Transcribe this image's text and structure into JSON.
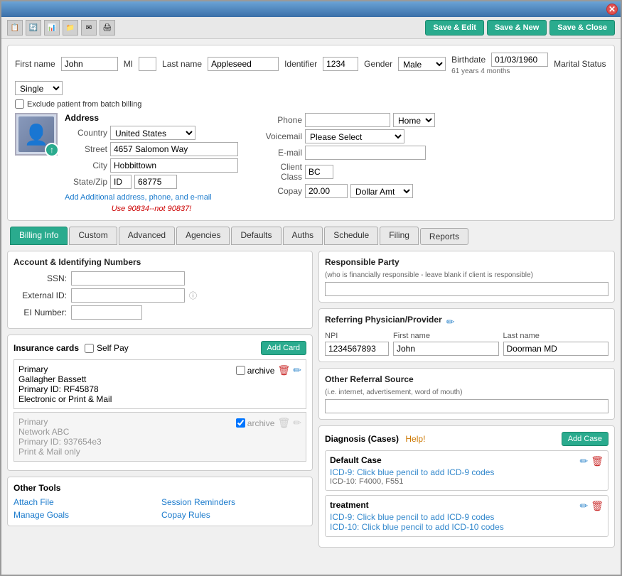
{
  "window": {
    "close_icon": "✕"
  },
  "toolbar": {
    "icons": [
      "📋",
      "🔄",
      "📊",
      "📁",
      "✉",
      "🖨"
    ],
    "save_edit": "Save & Edit",
    "save_new": "Save & New",
    "save_close": "Save & Close"
  },
  "patient": {
    "first_name_label": "First name",
    "first_name": "John",
    "mi_label": "MI",
    "last_name_label": "Last name",
    "last_name": "Appleseed",
    "identifier_label": "Identifier",
    "identifier": "1234",
    "gender_label": "Gender",
    "gender": "Male",
    "birthdate_label": "Birthdate",
    "birthdate": "01/03/1960",
    "birthdate_sub": "61 years 4 months",
    "marital_label": "Marital Status",
    "marital": "Single",
    "exclude_label": "Exclude patient from batch billing",
    "address_title": "Address",
    "country_label": "Country",
    "country": "United States",
    "street_label": "Street",
    "street": "4657 Salomon Way",
    "city_label": "City",
    "city": "Hobbittown",
    "state_label": "State/Zip",
    "state": "ID",
    "zip": "68775",
    "add_address_link": "Add Additional address, phone, and e-mail",
    "warning": "Use 90834--not 90837!",
    "phone_label": "Phone",
    "phone_type": "Home",
    "voicemail_label": "Voicemail",
    "voicemail_placeholder": "Please Select",
    "email_label": "E-mail",
    "client_class_label": "Client Class",
    "client_class": "BC",
    "copay_label": "Copay",
    "copay": "20.00",
    "copay_type": "Dollar Amt"
  },
  "tabs": {
    "billing_info": "Billing Info",
    "custom": "Custom",
    "advanced": "Advanced",
    "agencies": "Agencies",
    "defaults": "Defaults",
    "auths": "Auths",
    "schedule": "Schedule",
    "filing": "Filing",
    "reports": "Reports"
  },
  "account": {
    "title": "Account & Identifying Numbers",
    "ssn_label": "SSN:",
    "external_id_label": "External ID:",
    "ei_number_label": "EI Number:"
  },
  "insurance": {
    "title": "Insurance cards",
    "self_pay_label": "Self Pay",
    "add_card_label": "Add Card",
    "primary_card": {
      "type": "Primary",
      "name": "Gallagher Bassett",
      "id": "Primary ID: RF45878",
      "delivery": "Electronic or Print & Mail",
      "archive_label": "archive"
    },
    "secondary_card": {
      "type": "Primary",
      "name": "Network ABC",
      "id": "Primary ID: 937654e3",
      "delivery": "Print & Mail only",
      "archive_label": "archive"
    }
  },
  "other_tools": {
    "title": "Other Tools",
    "attach_file": "Attach File",
    "manage_goals": "Manage Goals",
    "session_reminders": "Session Reminders",
    "copay_rules": "Copay Rules"
  },
  "responsible_party": {
    "title": "Responsible Party",
    "subtitle": "(who is financially responsible - leave blank if client is responsible)"
  },
  "referring": {
    "title": "Referring Physician/Provider",
    "npi_header": "NPI",
    "first_name_header": "First name",
    "last_name_header": "Last name",
    "npi": "1234567893",
    "first_name": "John",
    "last_name": "Doorman MD",
    "edit_icon": "✏"
  },
  "other_referral": {
    "title": "Other Referral Source",
    "subtitle": "(i.e. internet, advertisement, word of mouth)"
  },
  "diagnosis": {
    "title": "Diagnosis (Cases)",
    "help_label": "Help!",
    "add_case_label": "Add Case",
    "cases": [
      {
        "name": "Default Case",
        "icd9_text": "ICD-9: Click blue pencil to add ICD-9 codes",
        "icd10_text": "ICD-10: F4000, F551"
      },
      {
        "name": "treatment",
        "icd9_text": "ICD-9: Click blue pencil to add ICD-9 codes",
        "icd10_text": "ICD-10: Click blue pencil to add ICD-10 codes"
      }
    ]
  }
}
